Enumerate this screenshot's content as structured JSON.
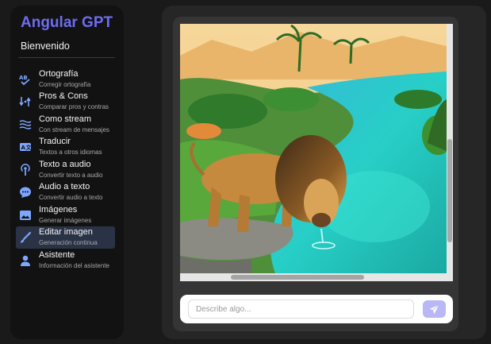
{
  "sidebar": {
    "title": "Angular GPT",
    "welcome": "Bienvenido",
    "items": [
      {
        "label": "Ortografía",
        "sub": "Corregir ortografía",
        "icon": "spellcheck-icon"
      },
      {
        "label": "Pros & Cons",
        "sub": "Comparar pros y contras",
        "icon": "compare-icon"
      },
      {
        "label": "Como stream",
        "sub": "Con stream de mensajes",
        "icon": "stream-icon"
      },
      {
        "label": "Traducir",
        "sub": "Textos a otros idiomas",
        "icon": "translate-icon"
      },
      {
        "label": "Texto a audio",
        "sub": "Convertir texto a audio",
        "icon": "podcast-icon"
      },
      {
        "label": "Audio a texto",
        "sub": "Convertir audio a texto",
        "icon": "chat-bubble-icon"
      },
      {
        "label": "Imágenes",
        "sub": "Generar imágenes",
        "icon": "image-icon"
      },
      {
        "label": "Editar imagen",
        "sub": "Generación continua",
        "icon": "brush-icon",
        "active": true
      },
      {
        "label": "Asistente",
        "sub": "Información del asistente",
        "icon": "user-icon"
      }
    ]
  },
  "chat": {
    "image_alt": "lion-drinking-at-oasis-image",
    "input_placeholder": "Describe algo...",
    "send_icon": "send-icon"
  },
  "colors": {
    "accent": "#6f6cf2",
    "sidebar_bg": "#121212",
    "active_item_bg": "#2a3346",
    "send_button": "#b9b7f5"
  }
}
